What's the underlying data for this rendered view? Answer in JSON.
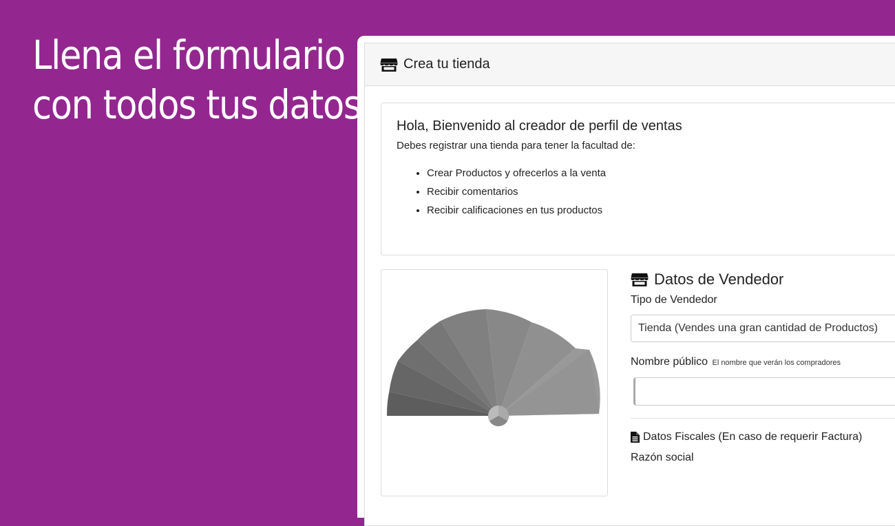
{
  "hero": {
    "line1": "Llena el formulario",
    "line2": "con todos tus datos"
  },
  "window": {
    "header_title": "Crea tu tienda",
    "header_icon": "store-icon"
  },
  "welcome": {
    "title": "Hola, Bienvenido al creador de perfil de ventas",
    "subtitle": "Debes registrar una tienda para tener la facultad de:",
    "items": [
      "Crear Productos y ofrecerlos a la venta",
      "Recibir comentarios",
      "Recibir calificaciones en tus productos"
    ]
  },
  "seller": {
    "section_title": "Datos de Vendedor",
    "section_icon": "store-icon",
    "type_label": "Tipo de Vendedor",
    "type_value": "Tienda (Vendes una gran cantidad de Productos)",
    "name_label": "Nombre público",
    "name_hint": "El nombre que verán los compradores",
    "name_value": "",
    "fiscal_title": "Datos Fiscales (En caso de requerir Factura)",
    "fiscal_icon": "document-icon",
    "razon_label": "Razón social"
  },
  "colors": {
    "background": "#93278f",
    "card_header": "#f6f6f6",
    "border": "#dcdcdc"
  }
}
